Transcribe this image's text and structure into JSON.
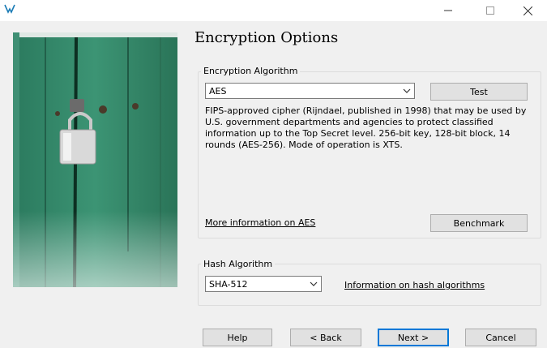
{
  "window": {
    "title": "",
    "controls": {
      "minimize": "minimize-icon",
      "maximize": "maximize-icon",
      "close": "close-icon"
    }
  },
  "page": {
    "title": "Encryption Options"
  },
  "encryption": {
    "group_label": "Encryption Algorithm",
    "algorithm": "AES",
    "test_label": "Test",
    "description": "FIPS-approved cipher (Rijndael, published in 1998) that may be used by U.S. government departments and agencies to protect classified information up to the Top Secret level. 256-bit key, 128-bit block, 14 rounds (AES-256). Mode of operation is XTS.",
    "more_info_link": "More information on AES",
    "benchmark_label": "Benchmark"
  },
  "hash": {
    "group_label": "Hash Algorithm",
    "algorithm": "SHA-512",
    "info_link": "Information on hash algorithms"
  },
  "footer": {
    "help": "Help",
    "back": "< Back",
    "next": "Next >",
    "cancel": "Cancel"
  },
  "colors": {
    "accent": "#0078d7",
    "panel_green": "#2f8a6c",
    "dialog_bg": "#f0f0f0"
  }
}
